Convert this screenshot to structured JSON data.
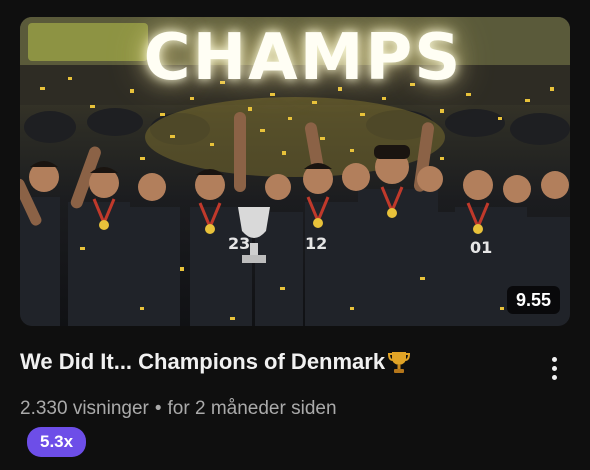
{
  "thumbnail": {
    "headline": "CHAMPS",
    "duration": "9.55"
  },
  "video": {
    "title": "We Did It... Champions of Denmark",
    "title_icon": "trophy-icon",
    "views": "2.330 visninger",
    "separator": "•",
    "age": "for 2 måneder siden",
    "badge": "5.3x"
  },
  "menu": {
    "icon": "more-vertical-icon"
  },
  "colors": {
    "background": "#0f0f0f",
    "title_text": "#f1f1f1",
    "meta_text": "#aaaaaa",
    "badge_bg": "#6d4ee8",
    "confetti": "#e8c23a"
  }
}
